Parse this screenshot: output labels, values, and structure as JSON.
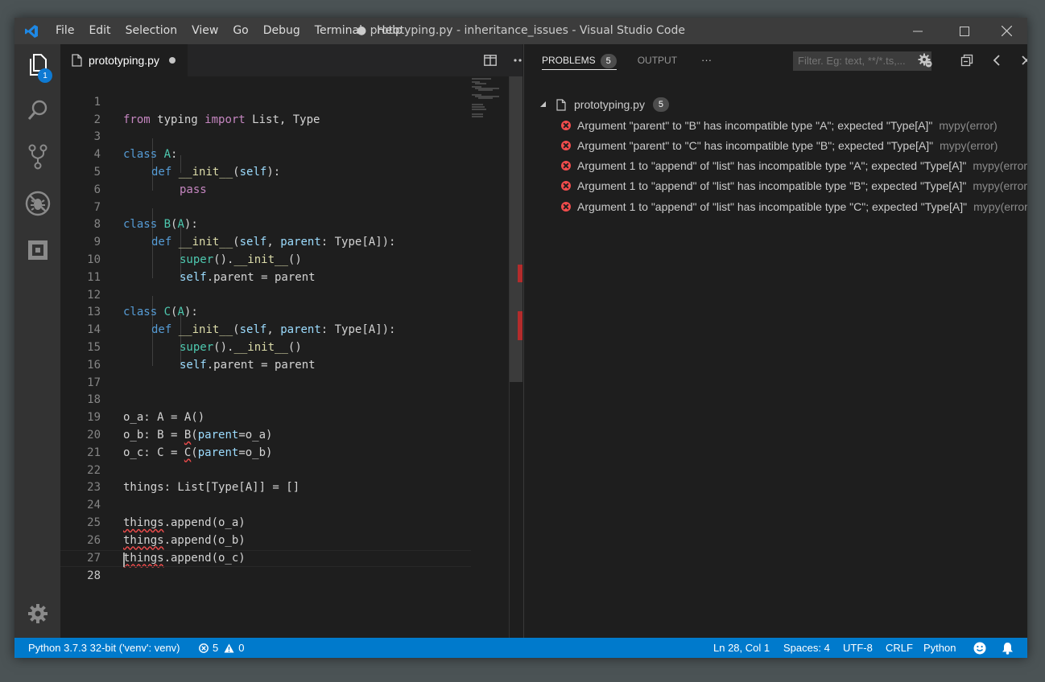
{
  "titlebar": {
    "menu": [
      "File",
      "Edit",
      "Selection",
      "View",
      "Go",
      "Debug",
      "Terminal",
      "Help"
    ],
    "window_title": "● prototyping.py - inheritance_issues - Visual Studio Code"
  },
  "activity": {
    "explorer_badge": "1"
  },
  "editor": {
    "tab_label": "prototyping.py",
    "line_numbers": [
      "1",
      "2",
      "3",
      "4",
      "5",
      "6",
      "7",
      "8",
      "9",
      "10",
      "11",
      "12",
      "13",
      "14",
      "15",
      "16",
      "17",
      "18",
      "19",
      "20",
      "21",
      "22",
      "23",
      "24",
      "25",
      "26",
      "27",
      "28"
    ],
    "code": {
      "l1_from": "from",
      "l1_a": " typing ",
      "l1_import": "import",
      "l1_b": " List, Type",
      "l3_class": "class",
      "l3_name": " A",
      "l3_rest": ":",
      "l4_def": "def",
      "l4_fn": "__init__",
      "l4_p": "(",
      "l4_self": "self",
      "l4_end": "):",
      "l5_pass": "pass",
      "l7_class": "class",
      "l7_name": " B",
      "l7_p": "(",
      "l7_base": "A",
      "l7_end": "):",
      "l8_def": "def",
      "l8_fn": "__init__",
      "l8_p": "(",
      "l8_self": "self",
      "l8_c": ", ",
      "l8_param": "parent",
      "l8_rest": ": Type[A]):",
      "l9_super": "super",
      "l9_a": "().",
      "l9_fn": "__init__",
      "l9_b": "()",
      "l10_self": "self",
      "l10_rest": ".parent = parent",
      "l12_class": "class",
      "l12_name": " C",
      "l12_p": "(",
      "l12_base": "A",
      "l12_end": "):",
      "l13_def": "def",
      "l13_fn": "__init__",
      "l13_p": "(",
      "l13_self": "self",
      "l13_c": ", ",
      "l13_param": "parent",
      "l13_rest": ": Type[A]):",
      "l14_super": "super",
      "l14_a": "().",
      "l14_fn": "__init__",
      "l14_b": "()",
      "l15_self": "self",
      "l15_rest": ".parent = parent",
      "l18": "o_a: A = A()",
      "l19_a": "o_b: B = ",
      "l19_call": "B",
      "l19_b": "(",
      "l19_param": "parent",
      "l19_c": "=o_a)",
      "l20_a": "o_c: C = ",
      "l20_call": "C",
      "l20_b": "(",
      "l20_param": "parent",
      "l20_c": "=o_b)",
      "l22": "things: List[Type[A]] = []",
      "l24_obj": "things",
      "l24_rest": ".append(o_a)",
      "l25_obj": "things",
      "l25_rest": ".append(o_b)",
      "l26_obj": "things",
      "l26_rest": ".append(o_c)"
    }
  },
  "panel": {
    "tab_problems": "PROBLEMS",
    "problems_count": "5",
    "tab_output": "OUTPUT",
    "more": "···",
    "filter_placeholder": "Filter. Eg: text, **/*.ts,...",
    "file_name": "prototyping.py",
    "file_count": "5",
    "problems": [
      {
        "message": "Argument \"parent\" to \"B\" has incompatible type \"A\"; expected \"Type[A]\"",
        "source": "mypy(error)"
      },
      {
        "message": "Argument \"parent\" to \"C\" has incompatible type \"B\"; expected \"Type[A]\"",
        "source": "mypy(error)"
      },
      {
        "message": "Argument 1 to \"append\" of \"list\" has incompatible type \"A\"; expected \"Type[A]\"",
        "source": "mypy(error)"
      },
      {
        "message": "Argument 1 to \"append\" of \"list\" has incompatible type \"B\"; expected \"Type[A]\"",
        "source": "mypy(error)"
      },
      {
        "message": "Argument 1 to \"append\" of \"list\" has incompatible type \"C\"; expected \"Type[A]\"",
        "source": "mypy(error)"
      }
    ]
  },
  "statusbar": {
    "interpreter": "Python 3.7.3 32-bit ('venv': venv)",
    "errors": "5",
    "warnings": "0",
    "position": "Ln 28, Col 1",
    "spaces": "Spaces: 4",
    "encoding": "UTF-8",
    "eol": "CRLF",
    "language": "Python"
  },
  "colors": {
    "accent": "#007acc",
    "error": "#f14c4c",
    "keyword": "#569cd6",
    "control": "#c586c0",
    "class": "#4ec9b0",
    "function": "#dcdcaa"
  }
}
